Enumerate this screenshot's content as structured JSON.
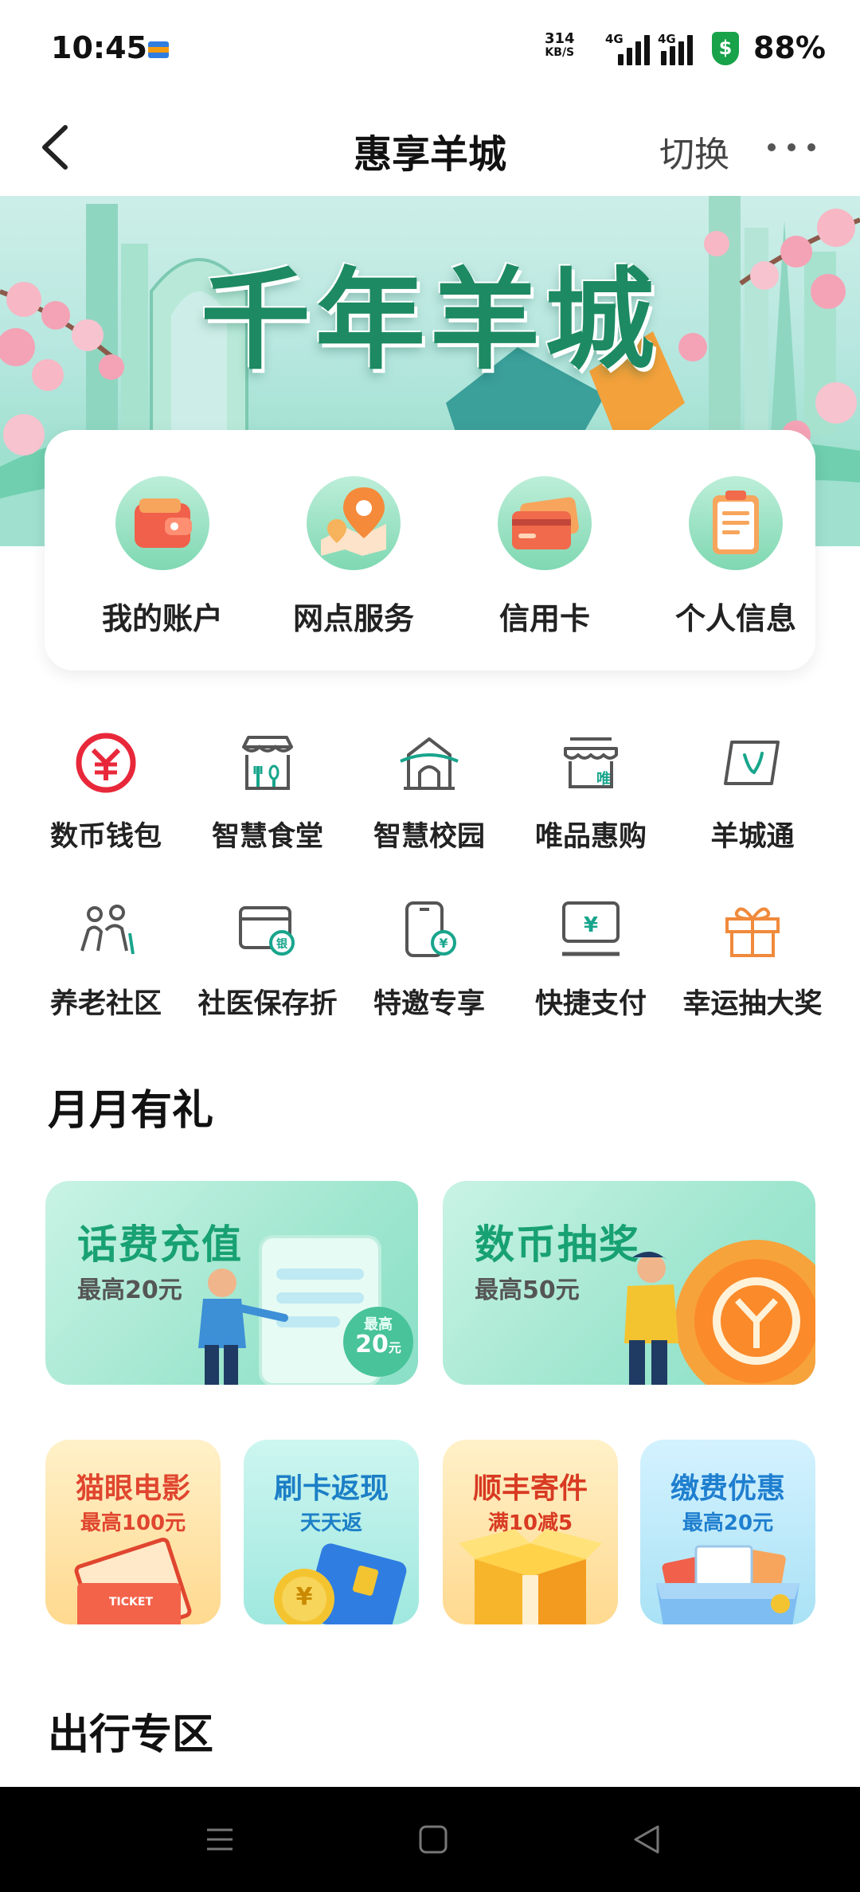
{
  "status_bar": {
    "time": "10:45",
    "speed_value": "314",
    "speed_unit": "KB/S",
    "signal1_label": "4G",
    "signal2_label": "4G",
    "battery": "88%"
  },
  "nav": {
    "title": "惠享羊城",
    "switch_label": "切换"
  },
  "banner": {
    "title": "千年羊城"
  },
  "quick_links": [
    {
      "label": "我的账户",
      "icon": "wallet-icon"
    },
    {
      "label": "网点服务",
      "icon": "location-pin-icon"
    },
    {
      "label": "信用卡",
      "icon": "credit-card-icon"
    },
    {
      "label": "个人信息",
      "icon": "clipboard-icon"
    }
  ],
  "service_grid": [
    {
      "label": "数币钱包",
      "icon": "digital-yuan-icon"
    },
    {
      "label": "智慧食堂",
      "icon": "canteen-icon"
    },
    {
      "label": "智慧校园",
      "icon": "campus-icon"
    },
    {
      "label": "唯品惠购",
      "icon": "shop-icon"
    },
    {
      "label": "羊城通",
      "icon": "yct-card-icon"
    },
    {
      "label": "养老社区",
      "icon": "elderly-icon"
    },
    {
      "label": "社医保存折",
      "icon": "medical-passbook-icon"
    },
    {
      "label": "特邀专享",
      "icon": "phone-yuan-icon"
    },
    {
      "label": "快捷支付",
      "icon": "quick-pay-icon"
    },
    {
      "label": "幸运抽大奖",
      "icon": "gift-icon"
    }
  ],
  "sections": {
    "monthly": "月月有礼",
    "travel": "出行专区"
  },
  "promo_big": [
    {
      "title": "话费充值",
      "subtitle": "最高20元",
      "badge_top": "最高",
      "badge_value": "20",
      "badge_unit": "元"
    },
    {
      "title": "数币抽奖",
      "subtitle": "最高50元"
    }
  ],
  "promo_small": [
    {
      "title": "猫眼电影",
      "subtitle": "最高100元",
      "ticket_text": "TICKET"
    },
    {
      "title": "刷卡返现",
      "subtitle": "天天返",
      "coin_text": "¥"
    },
    {
      "title": "顺丰寄件",
      "subtitle": "满10减5"
    },
    {
      "title": "缴费优惠",
      "subtitle": "最高20元"
    }
  ],
  "grid_icon_text": {
    "shop_badge": "唯",
    "passbook_badge": "银",
    "yuan": "¥"
  },
  "colors": {
    "accent_green": "#18a172",
    "icon_red": "#e8283a",
    "icon_gray": "#555555",
    "icon_teal": "#18a58c",
    "gift_orange": "#f08a3c"
  }
}
